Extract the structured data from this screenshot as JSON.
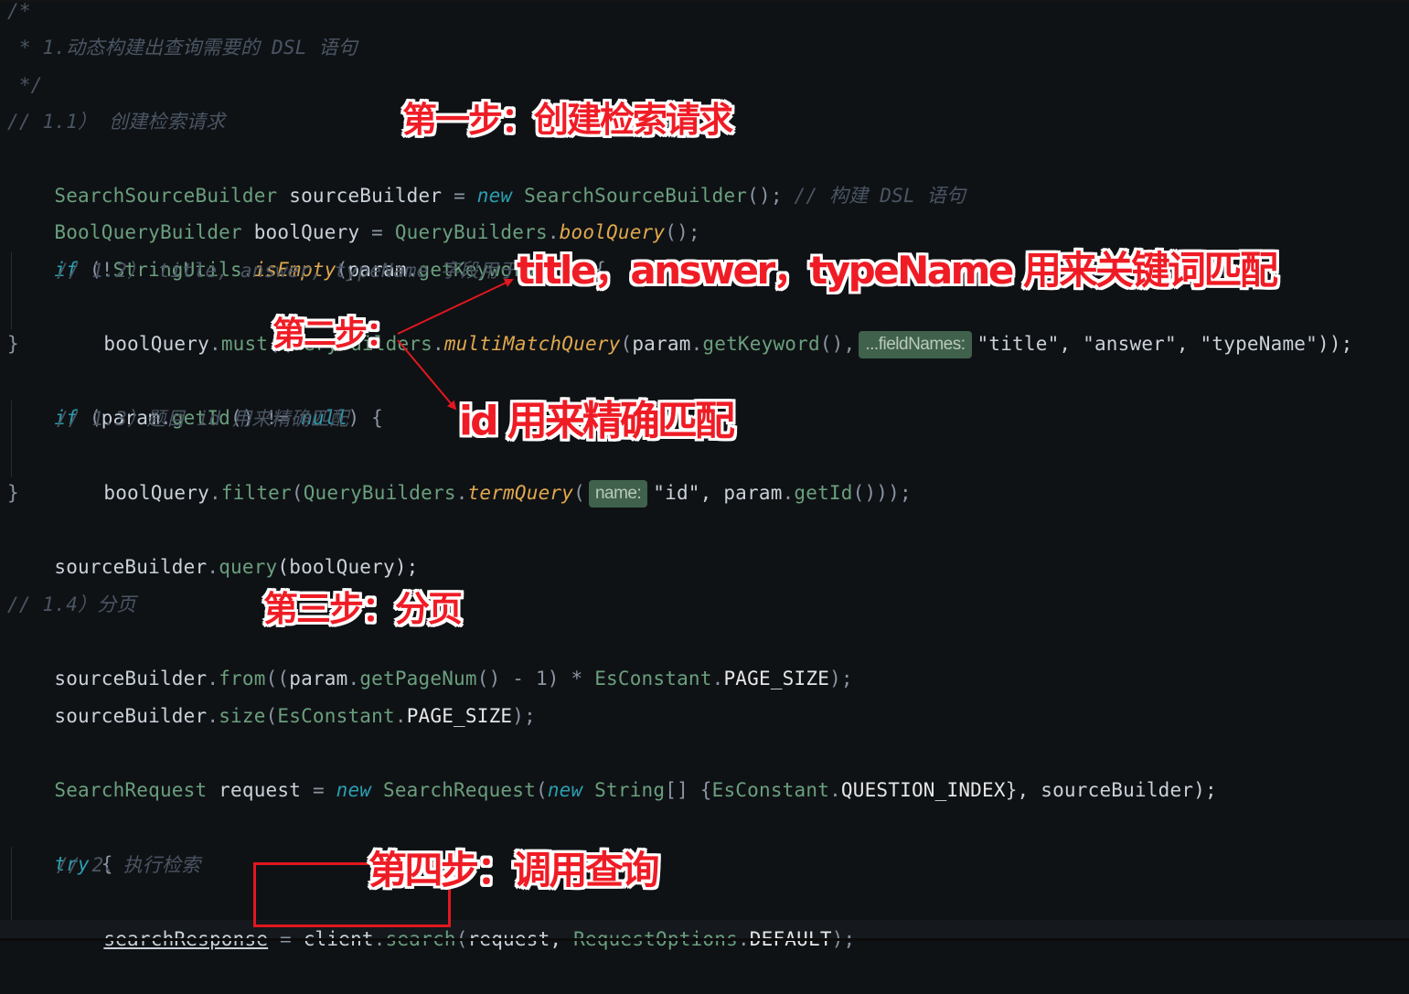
{
  "code": {
    "line1": "/*",
    "line2": " * 1.动态构建出查询需要的 DSL 语句",
    "line3": " */",
    "line4": "// 1.1） 创建检索请求",
    "line5": {
      "type": "SearchSourceBuilder",
      "var": " sourceBuilder ",
      "eq": "=",
      "kw_new": " new ",
      "ctor": "SearchSourceBuilder",
      "punc": "();",
      "comment": " // 构建 DSL 语句"
    },
    "line6": {
      "type": "BoolQueryBuilder",
      "var": " boolQuery ",
      "eq": "= ",
      "cls": "QueryBuilders",
      "dot": ".",
      "method": "boolQuery",
      "punc": "();"
    },
    "line7": {
      "kw_if": "if",
      "open": " (!",
      "cls": "StringUtils",
      "dot": ".",
      "method": "isEmpty",
      "paren": "(",
      "param": "param",
      "dot2": ".",
      "getter": "getKeyword",
      "close": "())) {"
    },
    "line8": "// 1.2） title, answer, typeName 字段用于检索",
    "line9": {
      "recv": "boolQuery",
      "dot": ".",
      "must": "must",
      "paren": "(",
      "cls": "QueryBuilders",
      "dot2": ".",
      "method": "multiMatchQuery",
      "paren2": "(",
      "param": "param",
      "dot3": ".",
      "getter": "getKeyword",
      "after": "(),",
      "hint": "...fieldNames:",
      "args": "\"title\", \"answer\", \"typeName\"));"
    },
    "line10": "}",
    "line11": {
      "kw_if": "if",
      "open": " (",
      "param": "param",
      "dot": ".",
      "getter": "getId",
      "mid": "() != ",
      "kw_null": "null",
      "close": ") {"
    },
    "line12": "// 1.3）题目 id 用来精确匹配",
    "line13": {
      "recv": "boolQuery",
      "dot": ".",
      "filter": "filter",
      "paren": "(",
      "cls": "QueryBuilders",
      "dot2": ".",
      "method": "termQuery",
      "paren2": "(",
      "hint": "name:",
      "arg1": "\"id\", ",
      "param": "param",
      "dot3": ".",
      "getter": "getId",
      "close": "()));"
    },
    "line14": "}",
    "line15": {
      "recv": "sourceBuilder",
      "dot": ".",
      "method": "query",
      "args": "(boolQuery);"
    },
    "line16": "// 1.4）分页",
    "line17": {
      "recv": "sourceBuilder",
      "dot": ".",
      "method": "from",
      "open": "((",
      "param": "param",
      "dot2": ".",
      "getter": "getPageNum",
      "mid": "() - 1) * ",
      "cls": "EsConstant",
      "dot3": ".",
      "const": "PAGE_SIZE",
      "close": ");"
    },
    "line18": {
      "recv": "sourceBuilder",
      "dot": ".",
      "method": "size",
      "open": "(",
      "cls": "EsConstant",
      "dot2": ".",
      "const": "PAGE_SIZE",
      "close": ");"
    },
    "line19": {
      "type": "SearchRequest",
      "var": " request ",
      "eq": "= ",
      "kw_new": "new",
      "ctor": " SearchRequest",
      "paren": "(",
      "kw_new2": "new",
      "strtype": " String",
      "arr": "[] {",
      "cls": "EsConstant",
      "dot": ".",
      "const": "QUESTION_INDEX",
      "close": "}, sourceBuilder);"
    },
    "line20": {
      "kw_try": "try",
      "brace": " {"
    },
    "line21": "// 2、执行检索",
    "line22": {
      "var": "searchResponse",
      "eq": " = ",
      "client": "client",
      "dot": ".",
      "method": "search",
      "paren": "(",
      "arg": "request, ",
      "cls": "RequestOptions",
      "dot2": ".",
      "const": "DEFAULT",
      "close": ");"
    }
  },
  "annotations": {
    "step1": "第一步：创建检索请求",
    "step2": "第二步：",
    "step2a": "title，answer，typeName 用来关键词匹配",
    "step2b": "id 用来精确匹配",
    "step3": "第三步：分页",
    "step4": "第四步：调用查询"
  },
  "colors": {
    "background": "#0f1215",
    "annotation_red": "#ef1c25",
    "hint_bg": "#40614b"
  }
}
